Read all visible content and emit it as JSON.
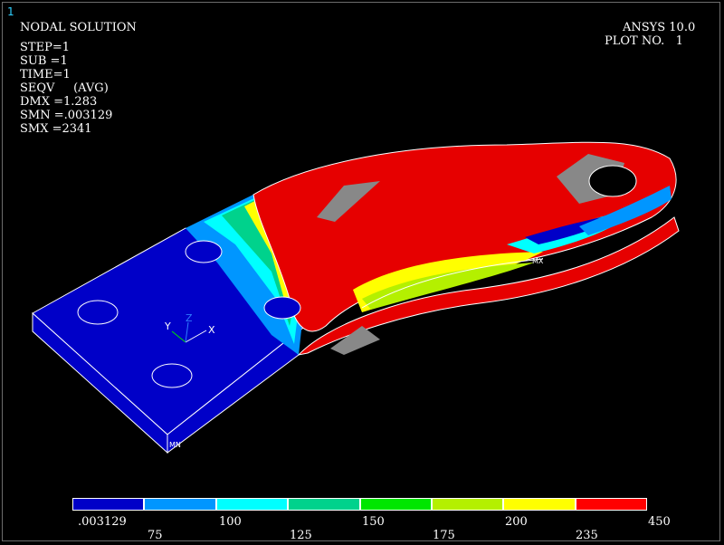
{
  "window_number": "1",
  "header": {
    "title": "NODAL SOLUTION",
    "program": "ANSYS 10.0",
    "plot_no": "PLOT NO.   1"
  },
  "solution_info": {
    "step": "STEP=1",
    "sub": "SUB =1",
    "time": "TIME=1",
    "seqv": "SEQV     (AVG)",
    "dmx": "DMX =1.283",
    "smn": "SMN =.003129",
    "smx": "SMX =2341"
  },
  "model_labels": {
    "mx": "MX",
    "mn": "MN",
    "axis_x": "X",
    "axis_y": "Y",
    "axis_z": "Z"
  },
  "legend": {
    "colors": [
      "#0000c8",
      "#0096ff",
      "#00ffff",
      "#00d28c",
      "#00e600",
      "#b4f000",
      "#ffff00",
      "#ff0000"
    ],
    "top_labels": [
      ".003129",
      "100",
      "150",
      "200",
      "450"
    ],
    "bottom_labels": [
      "75",
      "125",
      "175",
      "235"
    ]
  }
}
